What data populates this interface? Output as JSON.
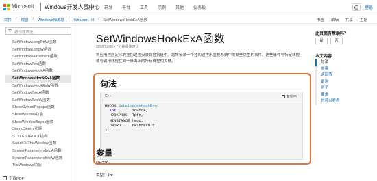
{
  "header": {
    "brand": "Microsoft",
    "site_title": "Windows开发人员中心",
    "nav": [
      "设计",
      "开发",
      "平台",
      "工具",
      "示例",
      "其他",
      "仪表板"
    ],
    "signin": "登录"
  },
  "breadcrumb": {
    "items": [
      "文件",
      "视窗",
      "Windows和消息",
      "Winuser。H"
    ],
    "current": "SetWindowsHookExA函数",
    "actions": [
      "书签",
      "编辑",
      "共享",
      "主题"
    ]
  },
  "sidebar": {
    "filter_placeholder": "按标题筛选",
    "items": [
      "SetWindowLongPtrW函数",
      "SetWindowLongW函数",
      "SetWindowPlacement函数",
      "SetWindowPos函数",
      "SetWindowsHookA函数",
      "SetWindowsHookExA函数",
      "SetWindowsHookExW函数",
      "SetWindowTextA函数",
      "SetWindowTextW函数",
      "ShowOwnedPopups函数",
      "ShowWindow功能",
      "ShowWindowAsync函数",
      "SoundSentry功能",
      "STYLESTRUCT结构",
      "SwitchToThisWindow函数",
      "SystemParametersInfoA函数",
      "SystemParametersInfoW函数",
      "TileWindows功能"
    ],
    "active_index": 5,
    "pdf_label": "下载PDF"
  },
  "main": {
    "title": "SetWindowsHookExA函数",
    "meta": "2018/12/05 • 7分钟阅读时长",
    "intro": "将应用程序定义的挂钩过程安装到挂钩链中。您将安装一个挂钩过程来监视系统中的某些类型的事件。这些事件与特定线程或与调用线程在同一桌面上的所有线程相关联。",
    "syntax_heading": "句法",
    "code_lang": "C++",
    "copy_label": "复制中",
    "params_heading": "参量",
    "param_first": "idHook",
    "type_label": "类型：",
    "type_value": "int"
  },
  "rail": {
    "help_title": "此页面有帮助吗？",
    "yes": "是",
    "no": "否",
    "toc_title": "本文内容",
    "toc": [
      "句法",
      "参量",
      "返回值",
      "备注",
      "例子",
      "要求",
      "也可以看看"
    ],
    "toc_current": 0
  },
  "colors": {
    "accent": "#0065b3",
    "highlight_border": "#e8703a"
  }
}
